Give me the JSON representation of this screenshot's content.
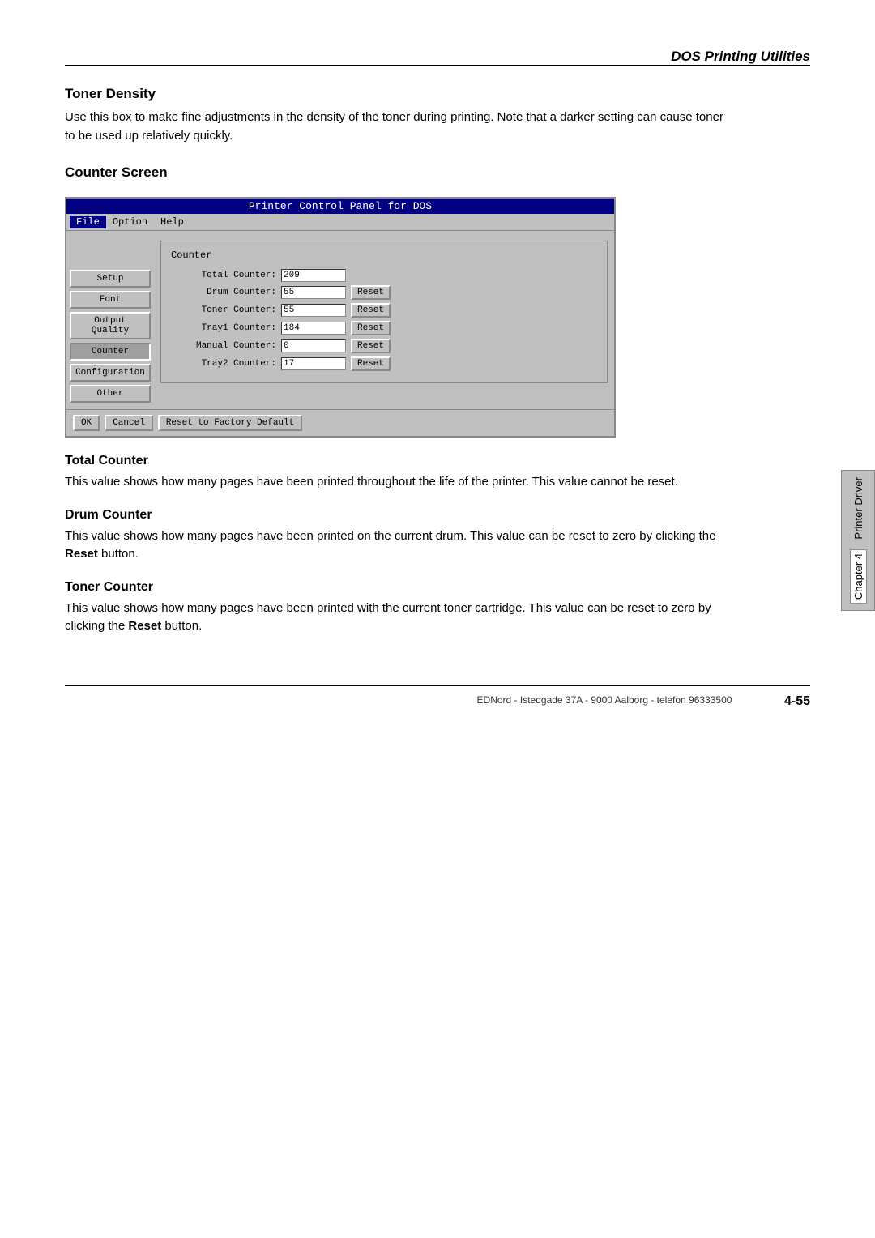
{
  "header": {
    "title": "DOS Printing Utilities"
  },
  "sections": {
    "toner_density": {
      "heading": "Toner Density",
      "body": "Use this box to make fine adjustments in the density of the toner during printing. Note that a darker setting can cause toner to be used up relatively quickly."
    },
    "counter_screen": {
      "heading": "Counter Screen"
    },
    "total_counter": {
      "heading": "Total Counter",
      "body": "This value shows how many pages have been printed throughout the life of the printer. This value cannot be reset."
    },
    "drum_counter": {
      "heading": "Drum Counter",
      "body1": "This value shows how many pages have been printed on the current drum. This value can be reset to zero by clicking the ",
      "bold": "Reset",
      "body2": " button."
    },
    "toner_counter": {
      "heading": "Toner Counter",
      "body1": "This value shows how many pages have been printed with the current toner cartridge. This value can be reset to zero by clicking the ",
      "bold": "Reset",
      "body2": " button."
    }
  },
  "dos_window": {
    "titlebar": "Printer Control Panel for DOS",
    "menu": {
      "file": "File",
      "option": "Option",
      "help": "Help"
    },
    "counter_panel": {
      "title": "Counter",
      "rows": [
        {
          "label": "Total Counter:",
          "value": "209",
          "has_reset": false
        },
        {
          "label": "Drum Counter:",
          "value": "55",
          "has_reset": true
        },
        {
          "label": "Toner Counter:",
          "value": "55",
          "has_reset": true
        },
        {
          "label": "Tray1 Counter:",
          "value": "184",
          "has_reset": true
        },
        {
          "label": "Manual Counter:",
          "value": "0",
          "has_reset": true
        },
        {
          "label": "Tray2 Counter:",
          "value": "17",
          "has_reset": true
        }
      ],
      "reset_label": "Reset"
    },
    "sidebar_buttons": [
      "Setup",
      "Font",
      "Output Quality",
      "Counter",
      "Configuration",
      "Other"
    ],
    "footer_buttons": [
      "OK",
      "Cancel",
      "Reset to Factory Default"
    ]
  },
  "right_tab": {
    "printer_driver": "Printer Driver",
    "chapter": "Chapter 4"
  },
  "footer": {
    "info": "EDNord - Istedgade 37A - 9000 Aalborg - telefon 96333500",
    "page_number": "4-55"
  }
}
